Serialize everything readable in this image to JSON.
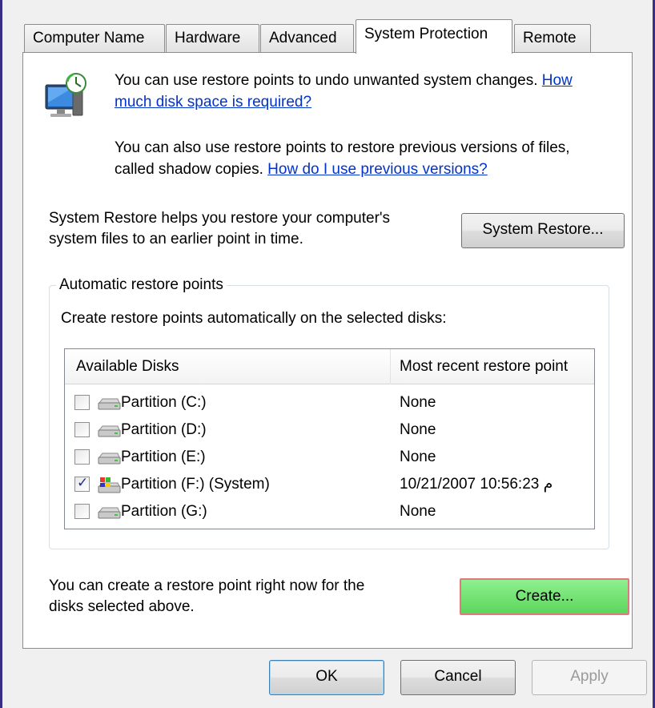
{
  "tabs": [
    "Computer Name",
    "Hardware",
    "Advanced",
    "System Protection",
    "Remote"
  ],
  "intro": {
    "text1": "You can use restore points to undo unwanted system changes.",
    "link1_part1": "How",
    "link1_part2": "much disk space is required?",
    "text2_line1": "You can also use restore points to restore previous versions of files,",
    "text2_line2": "called shadow copies.",
    "link2": "How do I use previous versions?"
  },
  "system_restore": {
    "line1": "System Restore helps you restore your computer's",
    "line2": "system files to an earlier point in time.",
    "button": "System Restore..."
  },
  "group": {
    "title": "Automatic restore points",
    "description": "Create restore points automatically on the selected disks:",
    "columns": [
      "Available Disks",
      "Most recent restore point"
    ],
    "rows": [
      {
        "name": "Partition (C:)",
        "date": "None",
        "checked": false,
        "icon": "drive-icon"
      },
      {
        "name": "Partition (D:)",
        "date": "None",
        "checked": false,
        "icon": "drive-icon"
      },
      {
        "name": "Partition (E:)",
        "date": "None",
        "checked": false,
        "icon": "drive-icon"
      },
      {
        "name": "Partition (F:) (System)",
        "date": "10/21/2007 10:56:23 م",
        "checked": true,
        "icon": "system-drive-icon"
      },
      {
        "name": "Partition (G:)",
        "date": "None",
        "checked": false,
        "icon": "drive-icon"
      }
    ]
  },
  "create": {
    "line1": "You can create a restore point right now for the",
    "line2": "disks selected above.",
    "button": "Create..."
  },
  "footer": {
    "ok": "OK",
    "cancel": "Cancel",
    "apply": "Apply"
  }
}
